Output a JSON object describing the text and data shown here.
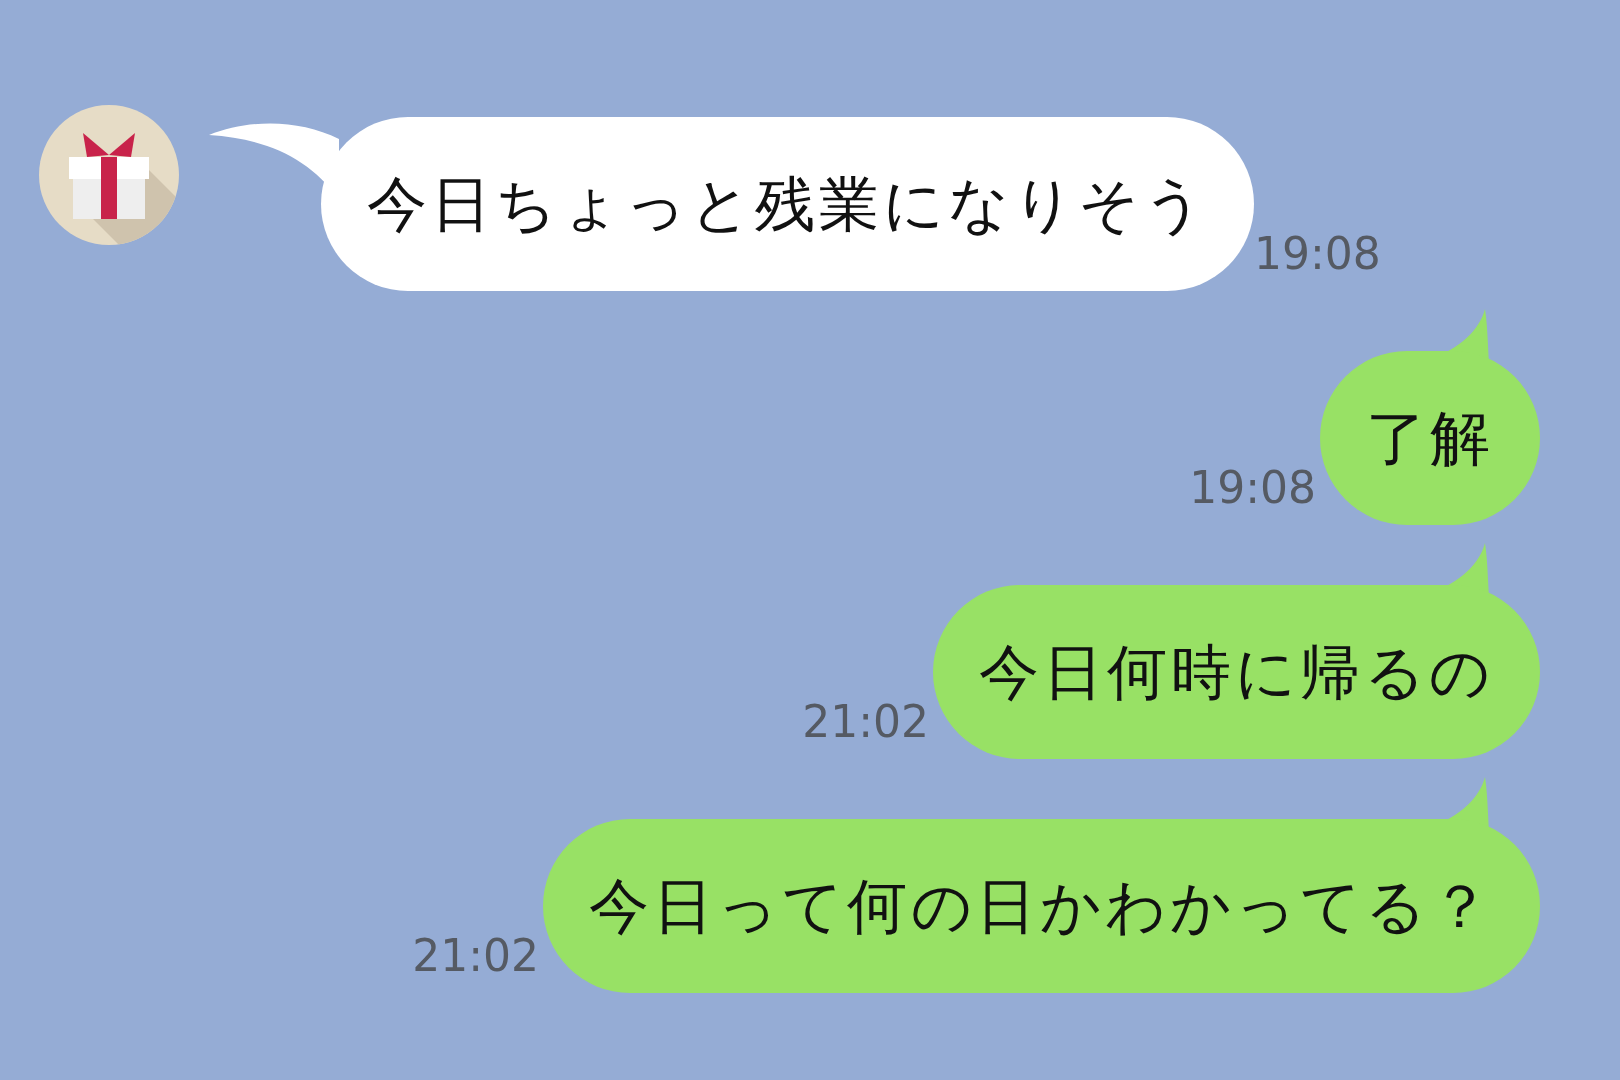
{
  "messages": [
    {
      "kind": "incoming",
      "text": "今日ちょっと残業になりそう",
      "time": "19:08"
    },
    {
      "kind": "outgoing",
      "text": "了解",
      "time": "19:08"
    },
    {
      "kind": "outgoing",
      "text": "今日何時に帰るの",
      "time": "21:02"
    },
    {
      "kind": "outgoing",
      "text": "今日って何の日かわかってる？",
      "time": "21:02"
    }
  ]
}
